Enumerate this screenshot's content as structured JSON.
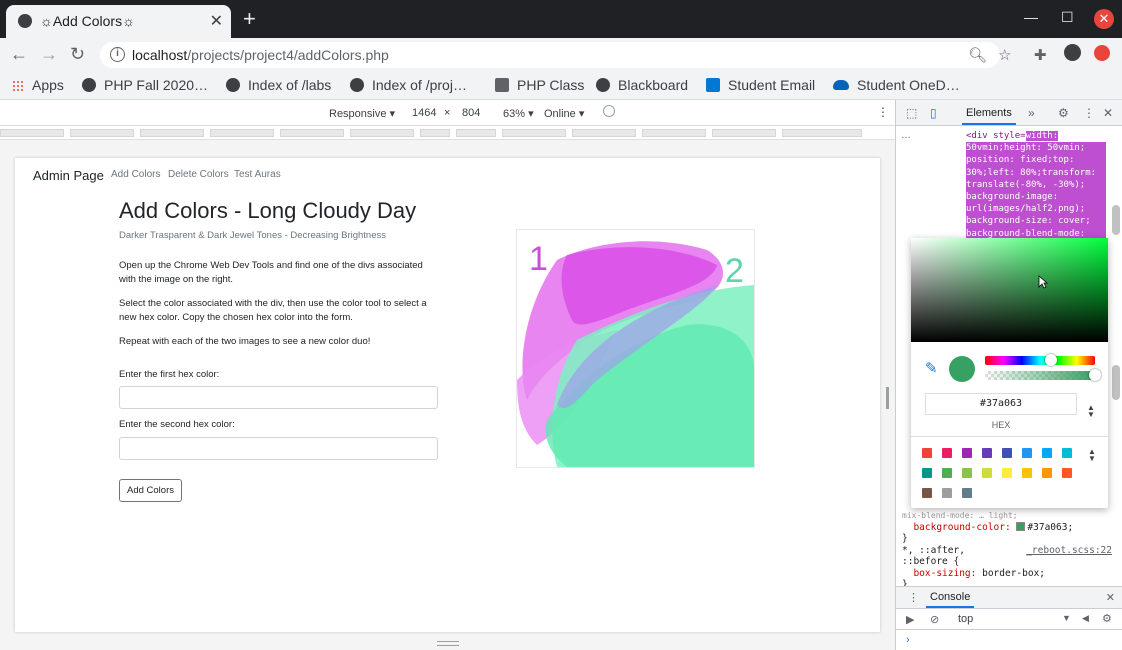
{
  "browser": {
    "tab_title": "☼Add Colors☼",
    "url_host": "localhost",
    "url_path": "/projects/project4/addColors.php"
  },
  "bookmarks": [
    {
      "label": "Apps",
      "icon": "apps-grid-icon"
    },
    {
      "label": "PHP Fall 2020…",
      "icon": "globe-icon"
    },
    {
      "label": "Index of /labs",
      "icon": "globe-icon"
    },
    {
      "label": "Index of /proj…",
      "icon": "globe-icon"
    },
    {
      "label": "PHP Class",
      "icon": "php-icon"
    },
    {
      "label": "Blackboard",
      "icon": "globe-icon"
    },
    {
      "label": "Student Email",
      "icon": "outlook-icon"
    },
    {
      "label": "Student OneD…",
      "icon": "onedrive-icon"
    }
  ],
  "device_toolbar": {
    "mode": "Responsive ▾",
    "width": "1464",
    "times": "×",
    "height": "804",
    "zoom": "63% ▾",
    "network": "Online ▾"
  },
  "page": {
    "brand": "Admin Page",
    "nav": [
      "Add Colors",
      "Delete Colors",
      "Test Auras"
    ],
    "heading": "Add Colors - Long Cloudy Day",
    "subheading": "Darker Trasparent & Dark Jewel Tones - Decreasing Brightness",
    "para1": "Open up the Chrome Web Dev Tools and find one of the divs associated with the image on the right.",
    "para2": "Select the color associated with the div, then use the color tool to select a new hex color. Copy the chosen hex color into the form.",
    "para3": "Repeat with each of the two images to see a new color duo!",
    "label1": "Enter the first hex color:",
    "label2": "Enter the second hex color:",
    "input1_value": "",
    "input2_value": "",
    "submit_label": "Add Colors",
    "art_label_1": "1",
    "art_label_2": "2"
  },
  "devtools": {
    "panel_tab": "Elements",
    "more_tabs": "»",
    "code_lines": [
      "<div style=\"width:",
      "50vmin;height: 50vmin;",
      "position: fixed;top:",
      "30%;left: 80%;transform:",
      "translate(-80%, -30%);",
      "background-image:",
      "url(images/half2.png);",
      "background-size: cover;",
      "background-blend-mode:"
    ],
    "picker": {
      "hex_value": "#37a063",
      "format_label": "HEX",
      "current_color": "#37a063",
      "palette": [
        "#f44336",
        "#e91e63",
        "#9c27b0",
        "#673ab7",
        "#3f51b5",
        "#2196f3",
        "#03a9f4",
        "#00bcd4",
        "#009688",
        "#4caf50",
        "#8bc34a",
        "#cddc39",
        "#ffeb3b",
        "#ffc107",
        "#ff9800",
        "#ff5722",
        "#795548",
        "#9e9e9e",
        "#607d8b"
      ]
    },
    "css": {
      "clipped_line": "mix-blend-mode: … light;",
      "bg_prop": "background-color:",
      "bg_value": "#37a063;",
      "close_brace": "}",
      "selector": "*, ::after,",
      "selector2": "::before {",
      "source": "_reboot.scss:22",
      "boxsizing_prop": "box-sizing:",
      "boxsizing_value": "border-box;",
      "close_brace2": "}"
    },
    "console": {
      "tab": "Console",
      "context": "top"
    }
  }
}
